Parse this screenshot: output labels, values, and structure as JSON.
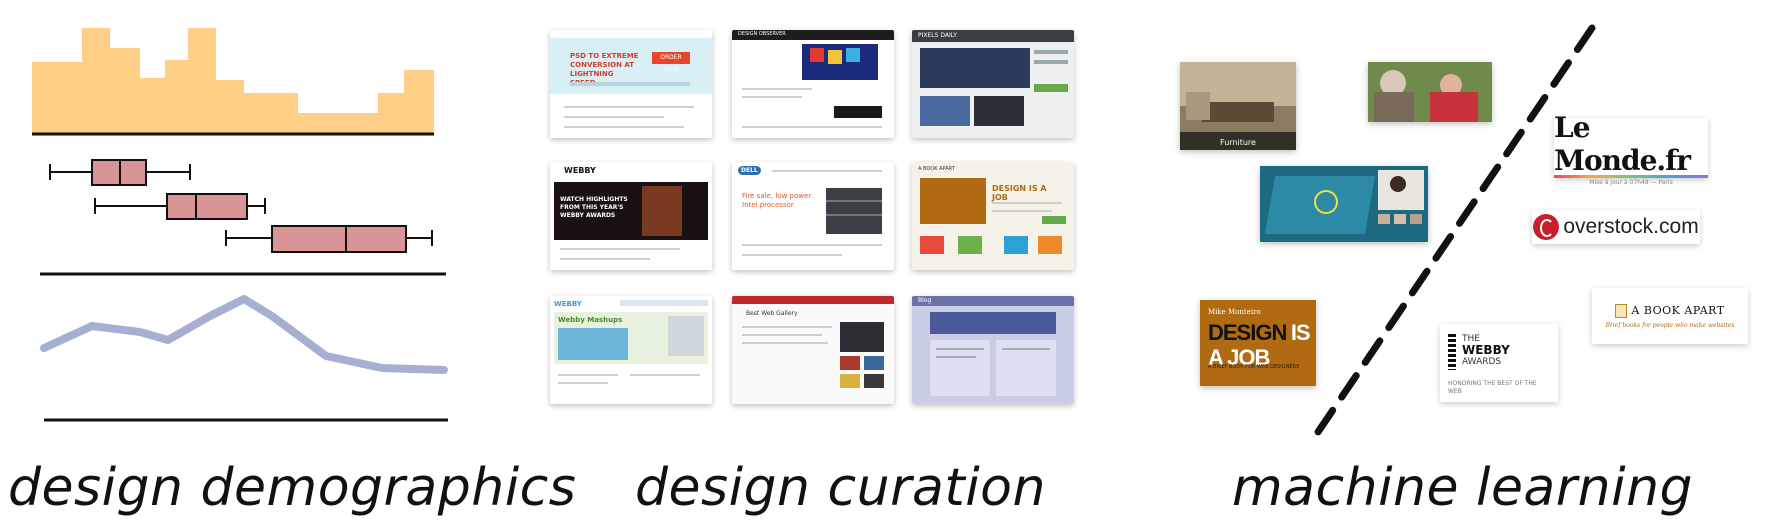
{
  "captions": {
    "demographics": "design demographics",
    "curation": "design curation",
    "ml": "machine learning"
  },
  "thumbs": {
    "t1_headline": "PSD TO EXTREME CONVERSION AT LIGHTNING SPEED",
    "t1_button": "ORDER NOW",
    "t2_brand": "DESIGN OBSERVER",
    "t3_brand": "PIXELS DAILY",
    "t4_brand": "WEBBY",
    "t4_headline": "WATCH HIGHLIGHTS FROM THIS YEAR'S WEBBY AWARDS",
    "t5_brand": "DELL",
    "t5_headline": "Fire sale, low power Intel processor",
    "t6_brand": "A BOOK APART",
    "t6_title": "DESIGN IS A JOB",
    "t7_brand": "WEBBY",
    "t7_title": "Webby Mashups",
    "t8_brand": "Best Web Gallery",
    "t9_brand": "Blog"
  },
  "ml": {
    "furniture_label": "Furniture",
    "lemonde": "Le Monde.fr",
    "lemonde_tagline": "Mise à jour à 07h48 — Paris",
    "overstock": "overstock.com",
    "dij_author": "Mike Monteiro",
    "dij_title_a": "DESIGN",
    "dij_title_b": "IS A JOB",
    "dij_subtitle": "A BRIEF BOOK FOR WEB DESIGNERS",
    "webby_the": "THE",
    "webby_name": "WEBBY",
    "webby_awards": "AWARDS",
    "webby_tag": "HONORING THE BEST OF THE WEB",
    "bookapart_name": "A BOOK APART",
    "bookapart_tag": "Brief books for people who make websites"
  },
  "colors": {
    "histogram": "#ffcf87",
    "boxplot": "#d99496",
    "line": "#a6afd2",
    "axis": "#111111",
    "dij_orange": "#b06a12"
  }
}
